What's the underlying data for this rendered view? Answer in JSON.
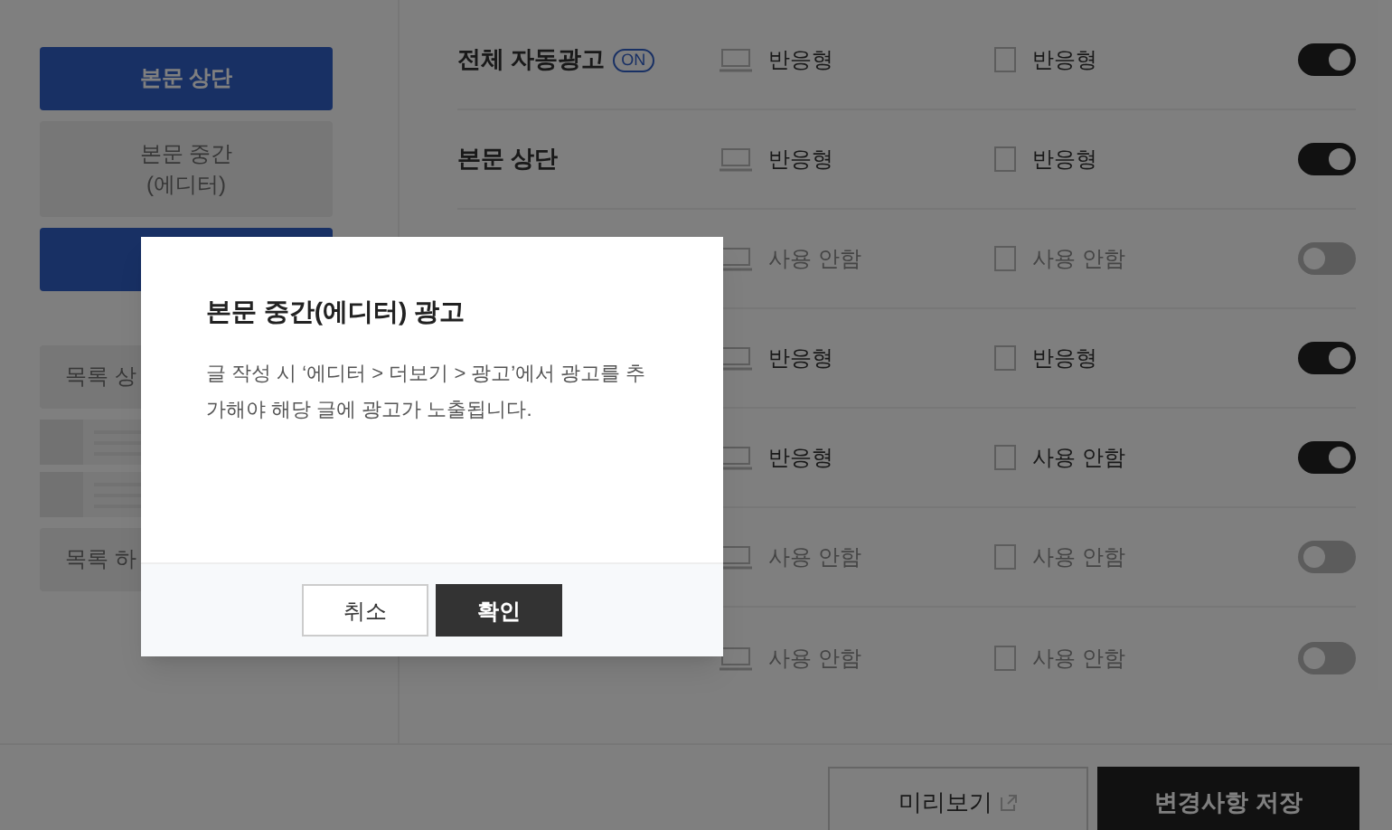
{
  "sidebar": {
    "items": [
      {
        "kind": "button",
        "label": "본문 상단",
        "selected": true
      },
      {
        "kind": "button",
        "label": "본문 중간\n(에디터)",
        "selected": false
      },
      {
        "kind": "button",
        "selected": true
      },
      {
        "kind": "button",
        "label": "목록 상",
        "selected": false
      },
      {
        "kind": "preview"
      },
      {
        "kind": "button",
        "label": "목록 하",
        "selected": false
      }
    ]
  },
  "rows": [
    {
      "label": "전체 자동광고",
      "badge": "ON",
      "pc": "반응형",
      "mobile": "반응형",
      "on": true
    },
    {
      "label": "본문 상단",
      "pc": "반응형",
      "mobile": "반응형",
      "on": true
    },
    {
      "pc": "사용 안함",
      "mobile": "사용 안함",
      "on": false
    },
    {
      "pc": "반응형",
      "mobile": "반응형",
      "on": true
    },
    {
      "pc": "반응형",
      "mobile": "사용 안함",
      "on": true
    },
    {
      "pc": "사용 안함",
      "mobile": "사용 안함",
      "on": false
    },
    {
      "pc": "사용 안함",
      "mobile": "사용 안함",
      "on": false
    }
  ],
  "footer": {
    "preview_button": "미리보기",
    "save_button": "변경사항 저장"
  },
  "dialog": {
    "title": "본문 중간(에디터) 광고",
    "body": "글 작성 시 ‘에디터 > 더보기 > 광고’에서 광고를 추가해야 해당 글에 광고가 노출됩니다.",
    "buttons": [
      {
        "label": "취소",
        "kind": "secondary"
      },
      {
        "label": "확인",
        "kind": "primary"
      }
    ]
  }
}
